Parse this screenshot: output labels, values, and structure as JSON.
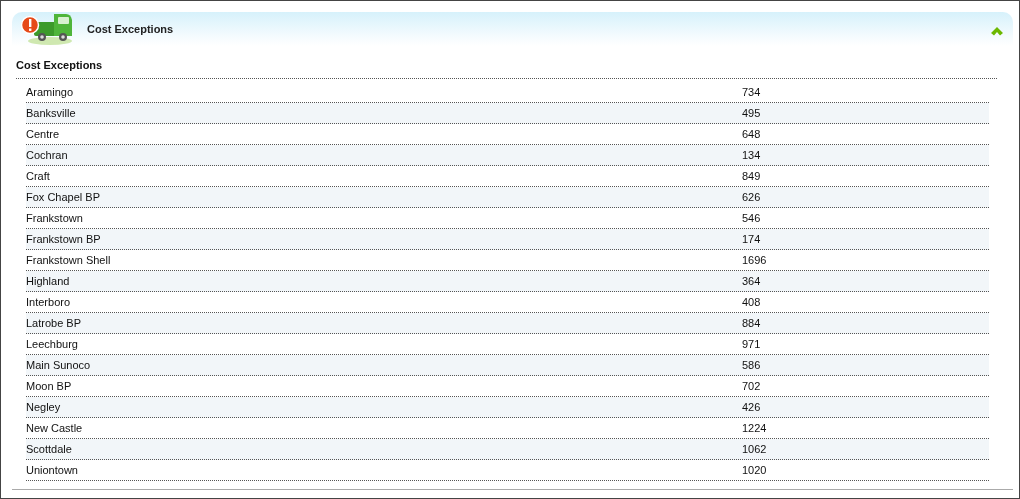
{
  "panel": {
    "title": "Cost Exceptions",
    "expanded": true
  },
  "section": {
    "title": "Cost Exceptions"
  },
  "rows": [
    {
      "name": "Aramingo",
      "value": "734"
    },
    {
      "name": "Banksville",
      "value": "495"
    },
    {
      "name": "Centre",
      "value": "648"
    },
    {
      "name": "Cochran",
      "value": "134"
    },
    {
      "name": "Craft",
      "value": "849"
    },
    {
      "name": "Fox Chapel BP",
      "value": "626"
    },
    {
      "name": "Frankstown",
      "value": "546"
    },
    {
      "name": "Frankstown BP",
      "value": "174"
    },
    {
      "name": "Frankstown Shell",
      "value": "1696"
    },
    {
      "name": "Highland",
      "value": "364"
    },
    {
      "name": "Interboro",
      "value": "408"
    },
    {
      "name": "Latrobe BP",
      "value": "884"
    },
    {
      "name": "Leechburg",
      "value": "971"
    },
    {
      "name": "Main Sunoco",
      "value": "586"
    },
    {
      "name": "Moon BP",
      "value": "702"
    },
    {
      "name": "Negley",
      "value": "426"
    },
    {
      "name": "New Castle",
      "value": "1224"
    },
    {
      "name": "Scottdale",
      "value": "1062"
    },
    {
      "name": "Uniontown",
      "value": "1020"
    }
  ]
}
